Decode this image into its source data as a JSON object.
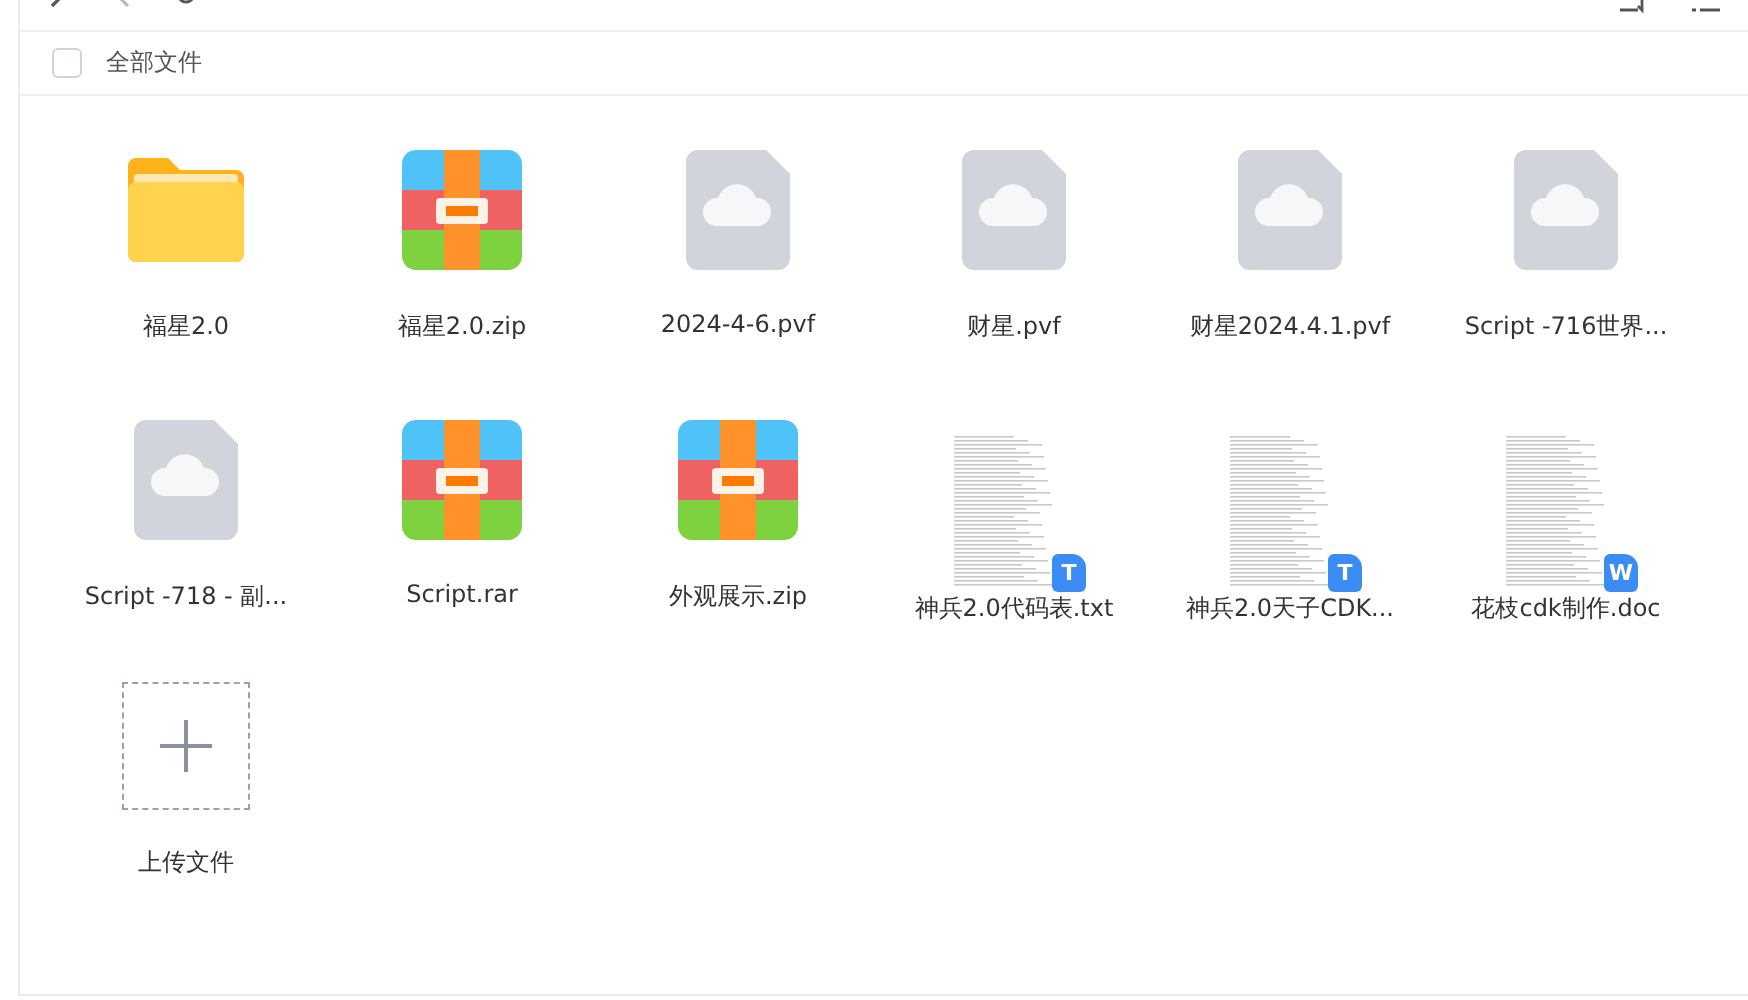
{
  "header": {
    "select_all": {
      "label": "全部文件",
      "checked": false
    }
  },
  "files": [
    {
      "kind": "folder",
      "name": "福星2.0"
    },
    {
      "kind": "archive",
      "name": "福星2.0.zip"
    },
    {
      "kind": "cloud",
      "name": "2024-4-6.pvf"
    },
    {
      "kind": "cloud",
      "name": "财星.pvf"
    },
    {
      "kind": "cloud",
      "name": "财星2024.4.1.pvf"
    },
    {
      "kind": "cloud",
      "name": "Script -716世界..."
    },
    {
      "kind": "cloud",
      "name": "Script -718 - 副..."
    },
    {
      "kind": "archive",
      "name": "Script.rar"
    },
    {
      "kind": "archive",
      "name": "外观展示.zip"
    },
    {
      "kind": "document",
      "name": "神兵2.0代码表.txt",
      "badge": "T"
    },
    {
      "kind": "document",
      "name": "神兵2.0天子CDK...",
      "badge": "T"
    },
    {
      "kind": "document",
      "name": "花枝cdk制作.doc",
      "badge": "W"
    },
    {
      "kind": "upload",
      "name": "上传文件"
    }
  ]
}
